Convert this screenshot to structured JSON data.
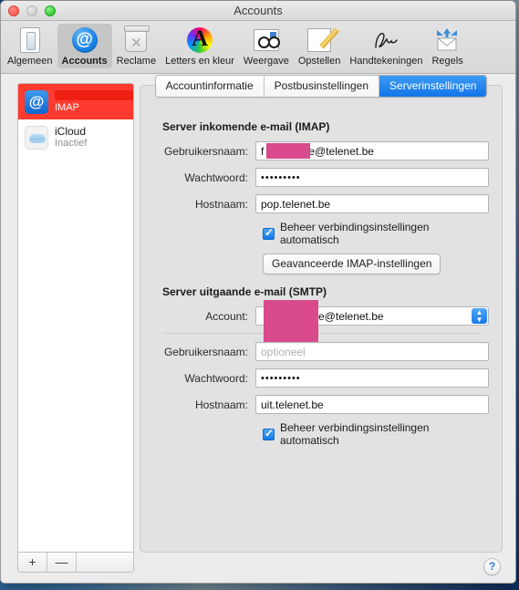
{
  "window": {
    "title": "Accounts",
    "traffic_lights": [
      "close-button",
      "minimize-button",
      "zoom-button"
    ]
  },
  "toolbar": {
    "items": [
      {
        "label": "Algemeen",
        "icon": "general-icon",
        "selected": false
      },
      {
        "label": "Accounts",
        "icon": "accounts-icon",
        "selected": true
      },
      {
        "label": "Reclame",
        "icon": "junk-icon",
        "selected": false
      },
      {
        "label": "Letters en kleur",
        "icon": "fonts-colors-icon",
        "selected": false
      },
      {
        "label": "Weergave",
        "icon": "viewing-icon",
        "selected": false
      },
      {
        "label": "Opstellen",
        "icon": "composing-icon",
        "selected": false
      },
      {
        "label": "Handtekeningen",
        "icon": "signatures-icon",
        "selected": false
      },
      {
        "label": "Regels",
        "icon": "rules-icon",
        "selected": false
      }
    ]
  },
  "sidebar": {
    "accounts": [
      {
        "name": "",
        "name_redacted": true,
        "type": "IMAP",
        "icon": "at-sign-icon",
        "selected": true
      },
      {
        "name": "iCloud",
        "name_redacted": false,
        "type": "Inactief",
        "icon": "icloud-icon",
        "selected": false
      }
    ],
    "footer": {
      "add_label": "+",
      "remove_label": "—"
    }
  },
  "tabs": [
    {
      "label": "Accountinformatie",
      "active": false
    },
    {
      "label": "Postbusinstellingen",
      "active": false
    },
    {
      "label": "Serverinstellingen",
      "active": true
    }
  ],
  "incoming": {
    "section_title": "Server inkomende e-mail (IMAP)",
    "username_label": "Gebruikersnaam:",
    "username_prefix": "f",
    "username_suffix": "e@telenet.be",
    "password_label": "Wachtwoord:",
    "password_value": "•••••••••",
    "hostname_label": "Hostnaam:",
    "hostname_value": "pop.telenet.be",
    "auto_label": "Beheer verbindingsinstellingen automatisch",
    "auto_checked": true,
    "advanced_button": "Geavanceerde IMAP-instellingen"
  },
  "outgoing": {
    "section_title": "Server uitgaande e-mail (SMTP)",
    "account_label": "Account:",
    "account_value": "e@telenet.be",
    "username_label": "Gebruikersnaam:",
    "username_placeholder": "optioneel",
    "username_value": "",
    "password_label": "Wachtwoord:",
    "password_value": "•••••••••",
    "hostname_label": "Hostnaam:",
    "hostname_value": "uit.telenet.be",
    "auto_label": "Beheer verbindingsinstellingen automatisch",
    "auto_checked": true
  },
  "help": {
    "label": "?"
  },
  "colors": {
    "selection_red": "#ff3b30",
    "accent_blue": "#1175e8",
    "redaction_pink": "#d94a8c",
    "redaction_red": "#ef1f12",
    "window_bg": "#ececec",
    "panel_bg": "#e2e2e2"
  }
}
